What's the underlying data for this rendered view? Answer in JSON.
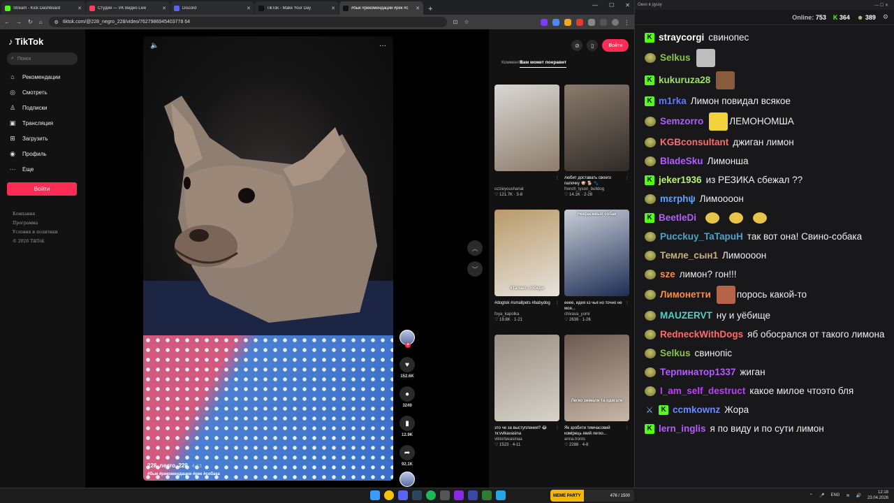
{
  "tabs": [
    {
      "title": "Stream - Kick Dashboard",
      "color": "#53fc18"
    },
    {
      "title": "Студия — VK Видео Live",
      "color": "#ff3d5a"
    },
    {
      "title": "Discord",
      "color": "#5865f2"
    },
    {
      "title": "TikTok - Make Your Day",
      "color": "#111111"
    },
    {
      "title": "#бык #рекомендации #рек #с",
      "color": "#111111"
    }
  ],
  "address": {
    "url": "tiktok.com/@228_negro_228/video/7627986945403778 64"
  },
  "tiktok": {
    "logo": "TikTok",
    "search_placeholder": "Поиск",
    "nav": [
      {
        "label": "Рекомендации",
        "icon": "home-icon"
      },
      {
        "label": "Смотреть",
        "icon": "compass-icon"
      },
      {
        "label": "Подписки",
        "icon": "person-icon"
      },
      {
        "label": "Трансляция",
        "icon": "live-icon"
      },
      {
        "label": "Загрузить",
        "icon": "upload-icon"
      },
      {
        "label": "Профиль",
        "icon": "profile-icon"
      },
      {
        "label": "Еще",
        "icon": "more-icon"
      }
    ],
    "login": "Войти",
    "footer": [
      "Компания",
      "Программа",
      "Условия и политики",
      "© 2026 TikTok"
    ],
    "video": {
      "user": "228_negro_228",
      "date": "4-13",
      "tags": "#бык #рекомендации #рек #собака"
    },
    "actions": {
      "likes": "152.6K",
      "comments": "3249",
      "saves": "12.9K",
      "shares": "92.1K"
    },
    "right": {
      "login": "Войти",
      "tab_comments": "Коммента",
      "tab_like": "Вам может понравит",
      "cards": [
        {
          "title": "",
          "author": "ozzieyoushanat",
          "stats": "121.7K · 3-8",
          "c1": "#8d7d6c",
          "c2": "#d9d7d4",
          "overlay": ""
        },
        {
          "title": "любит доставать своего папочку 🐶 🐕 🐾",
          "author": "french_tyson_bulldog",
          "stats": "14.1K · 2-28",
          "c1": "#2f2a27",
          "c2": "#8a7b6c",
          "overlay": ""
        },
        {
          "title": "#dogtok #smallpets #babydog",
          "author": "foya_kapolka",
          "stats": "19.8K · 1-21",
          "c1": "#e7e3dc",
          "c2": "#b99a6a",
          "overlay": "#Талант, победи"
        },
        {
          "title": "еееe, идея хз чья но точно не моя...",
          "author": "chivava_yumi",
          "stats": "2639 · 1-26",
          "c1": "#1e2d54",
          "c2": "#c9cfd8",
          "overlay": "Некрасивых собак"
        },
        {
          "title": "это че за выступления? 😂 тк:vvlkavasina",
          "author": "viktorlavasinaa",
          "stats": "1523 · 4-11",
          "c1": "#d8d2c8",
          "c2": "#9a9085",
          "overlay": ""
        },
        {
          "title": "Як зробити тимчасовий комірець який легко...",
          "author": "anna.tronts",
          "stats": "2288 · 4-8",
          "c1": "#c6b7a8",
          "c2": "#6a5a50",
          "overlay": "Легко знімати та одягати"
        }
      ]
    }
  },
  "chat": {
    "window_title": "Окно в душу",
    "online_label": "Online:",
    "online": "753",
    "kick_count": "364",
    "other_count": "389",
    "messages": [
      {
        "badge": "kick",
        "user": "straycorgi",
        "color": "#ffffff",
        "text": "свинопес",
        "emotes": []
      },
      {
        "badge": "face",
        "user": "Selkus",
        "color": "#8bc34a",
        "text": "",
        "emotes": [
          "#bdbdbd"
        ]
      },
      {
        "badge": "kick",
        "user": "kukuruza28",
        "color": "#9fe06a",
        "text": "",
        "emotes": [
          "#8a5a3c"
        ]
      },
      {
        "badge": "kick",
        "user": "m1rka",
        "color": "#5c7cfa",
        "text": "Лимон повидал всякое",
        "emotes": []
      },
      {
        "badge": "face",
        "user": "Semzorro",
        "color": "#b35cff",
        "text": "ЛЕМОНОМША",
        "emotes": [
          "#f2d33b"
        ]
      },
      {
        "badge": "face",
        "user": "KGBconsultant",
        "color": "#ff6b6b",
        "text": "джиган лимон",
        "emotes": []
      },
      {
        "badge": "face",
        "user": "BladeSku",
        "color": "#b35cff",
        "text": "Лимонша",
        "emotes": []
      },
      {
        "badge": "kick",
        "user": "jeker1936",
        "color": "#b9f36c",
        "text": "из РЕЗИКА сбежал ??",
        "emotes": []
      },
      {
        "badge": "face",
        "user": "mɛrphψ",
        "color": "#5ea3ff",
        "text": "Лимоооон",
        "emotes": []
      },
      {
        "badge": "kick",
        "user": "BeetleDi",
        "color": "#b35cff",
        "text": "",
        "emotes": [
          "#e8c34a",
          "#e8c34a",
          "#e8c34a"
        ]
      },
      {
        "badge": "face",
        "user": "Pucckuy_TaTapuH",
        "color": "#4fa3c7",
        "text": "так вот она! Свино-собака",
        "emotes": []
      },
      {
        "badge": "face",
        "user": "Темле_сын1",
        "color": "#c9b27a",
        "text": "Лимоооон",
        "emotes": []
      },
      {
        "badge": "face",
        "user": "sze",
        "color": "#ff8c42",
        "text": "лимон? гон!!!",
        "emotes": []
      },
      {
        "badge": "face",
        "user": "Лимонетти",
        "color": "#ff8c42",
        "text": "порось какой-то",
        "emotes": [
          "#b5644a"
        ]
      },
      {
        "badge": "face",
        "user": "MAUZERVT",
        "color": "#4fd1c5",
        "text": "ну и уёбище",
        "emotes": []
      },
      {
        "badge": "face",
        "user": "RedneckWithDogs",
        "color": "#ff6b6b",
        "text": "яб обосрался от такого лимона",
        "emotes": []
      },
      {
        "badge": "face",
        "user": "Selkus",
        "color": "#8bc34a",
        "text": "свинопіс",
        "emotes": []
      },
      {
        "badge": "face",
        "user": "Терпинатор1337",
        "color": "#b35cff",
        "text": "жиган",
        "emotes": []
      },
      {
        "badge": "face",
        "user": "I_am_self_destruct",
        "color": "#c13cff",
        "text": "какое милое чтоэто бля",
        "emotes": []
      },
      {
        "badge": "sword",
        "user": "ccmkownz",
        "color": "#6a8cff",
        "text": "Жора",
        "emotes": []
      },
      {
        "badge": "kick",
        "user": "lern_inglis",
        "color": "#b35cff",
        "text": "я по виду и по сути лимон",
        "emotes": []
      }
    ]
  },
  "taskbar": {
    "meme_label": "MEME PARTY",
    "meme_count": "476 / 1500",
    "lang": "ENG",
    "time": "12:18",
    "date": "23.04.2026"
  }
}
